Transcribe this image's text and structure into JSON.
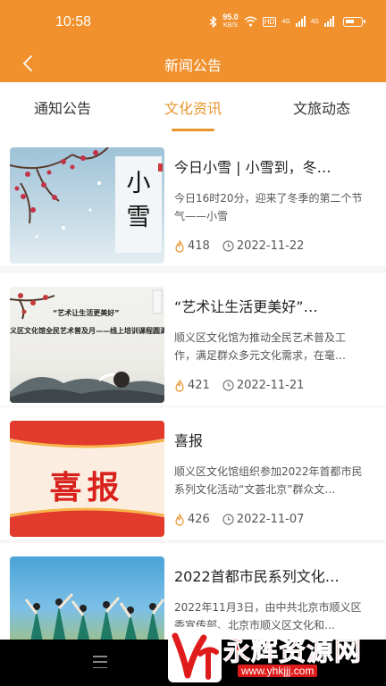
{
  "status_bar": {
    "time": "10:58",
    "speed_value": "95.0",
    "speed_unit": "KB/S",
    "hd_label": "HD",
    "net_label_1": "4G",
    "net_label_2": "4G"
  },
  "navbar": {
    "title": "新闻公告",
    "back_icon": "chevron-left-icon"
  },
  "tabs": [
    {
      "label": "通知公告",
      "active": false
    },
    {
      "label": "文化资讯",
      "active": true
    },
    {
      "label": "文旅动态",
      "active": false
    }
  ],
  "news": [
    {
      "title": "今日小雪 | 小雪到，冬…",
      "desc": "今日16时20分，迎来了冬季的第二个节气——小雪",
      "views": "418",
      "date": "2022-11-22",
      "thumb_text": "小雪"
    },
    {
      "title": "“艺术让生活更美好”…",
      "desc": "顺义区文化馆为推动全民艺术普及工作，满足群众多元文化需求，在毫…",
      "views": "421",
      "date": "2022-11-21",
      "thumb_caption_1": "“艺术让生活更美好”",
      "thumb_caption_2": "义区文化馆全民艺术普及月——线上培训课程圆满结"
    },
    {
      "title": "喜报",
      "desc": "顺义区文化馆组织参加2022年首都市民系列文化活动“文荟北京”群众文…",
      "views": "426",
      "date": "2022-11-07",
      "thumb_text": "喜报"
    },
    {
      "title": "2022首都市民系列文化…",
      "desc": "2022年11月3日，由中共北京市顺义区委宣传部、北京市顺义区文化和…"
    }
  ],
  "watermark": {
    "text": "永辉资源网",
    "url": "www.yhkjjj.com"
  },
  "colors": {
    "brand": "#f0912d",
    "accent": "#e8952c",
    "red": "#e01b1b"
  }
}
